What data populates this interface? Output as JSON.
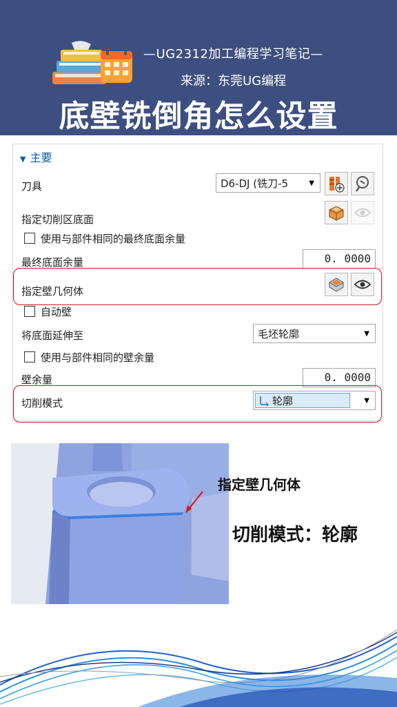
{
  "header": {
    "subtitle": "—UG2312加工编程学习笔记—",
    "source": "来源：东莞UG编程",
    "title": "底壁铣倒角怎么设置"
  },
  "panel": {
    "section": "主要",
    "tool_label": "刀具",
    "tool_value": "D6-DJ (铣刀-5",
    "floor_label": "指定切削区底面",
    "use_floor_stock": "使用与部件相同的最终底面余量",
    "final_floor_stock_label": "最终底面余量",
    "final_floor_stock_value": "0. 0000",
    "wall_geom_label": "指定壁几何体",
    "auto_wall": "自动壁",
    "extend_floor_label": "将底面延伸至",
    "extend_floor_value": "毛坯轮廓",
    "use_wall_stock": "使用与部件相同的壁余量",
    "wall_stock_label": "壁余量",
    "wall_stock_value": "0. 0000",
    "cut_mode_label": "切削模式",
    "cut_mode_value": "轮廓"
  },
  "annotations": {
    "wall_geom": "指定壁几何体",
    "cut_mode": "切削模式：轮廓"
  },
  "colors": {
    "header_bg": "#3d4f80",
    "highlight": "#c8161d",
    "section_blue": "#0a5aa8"
  }
}
